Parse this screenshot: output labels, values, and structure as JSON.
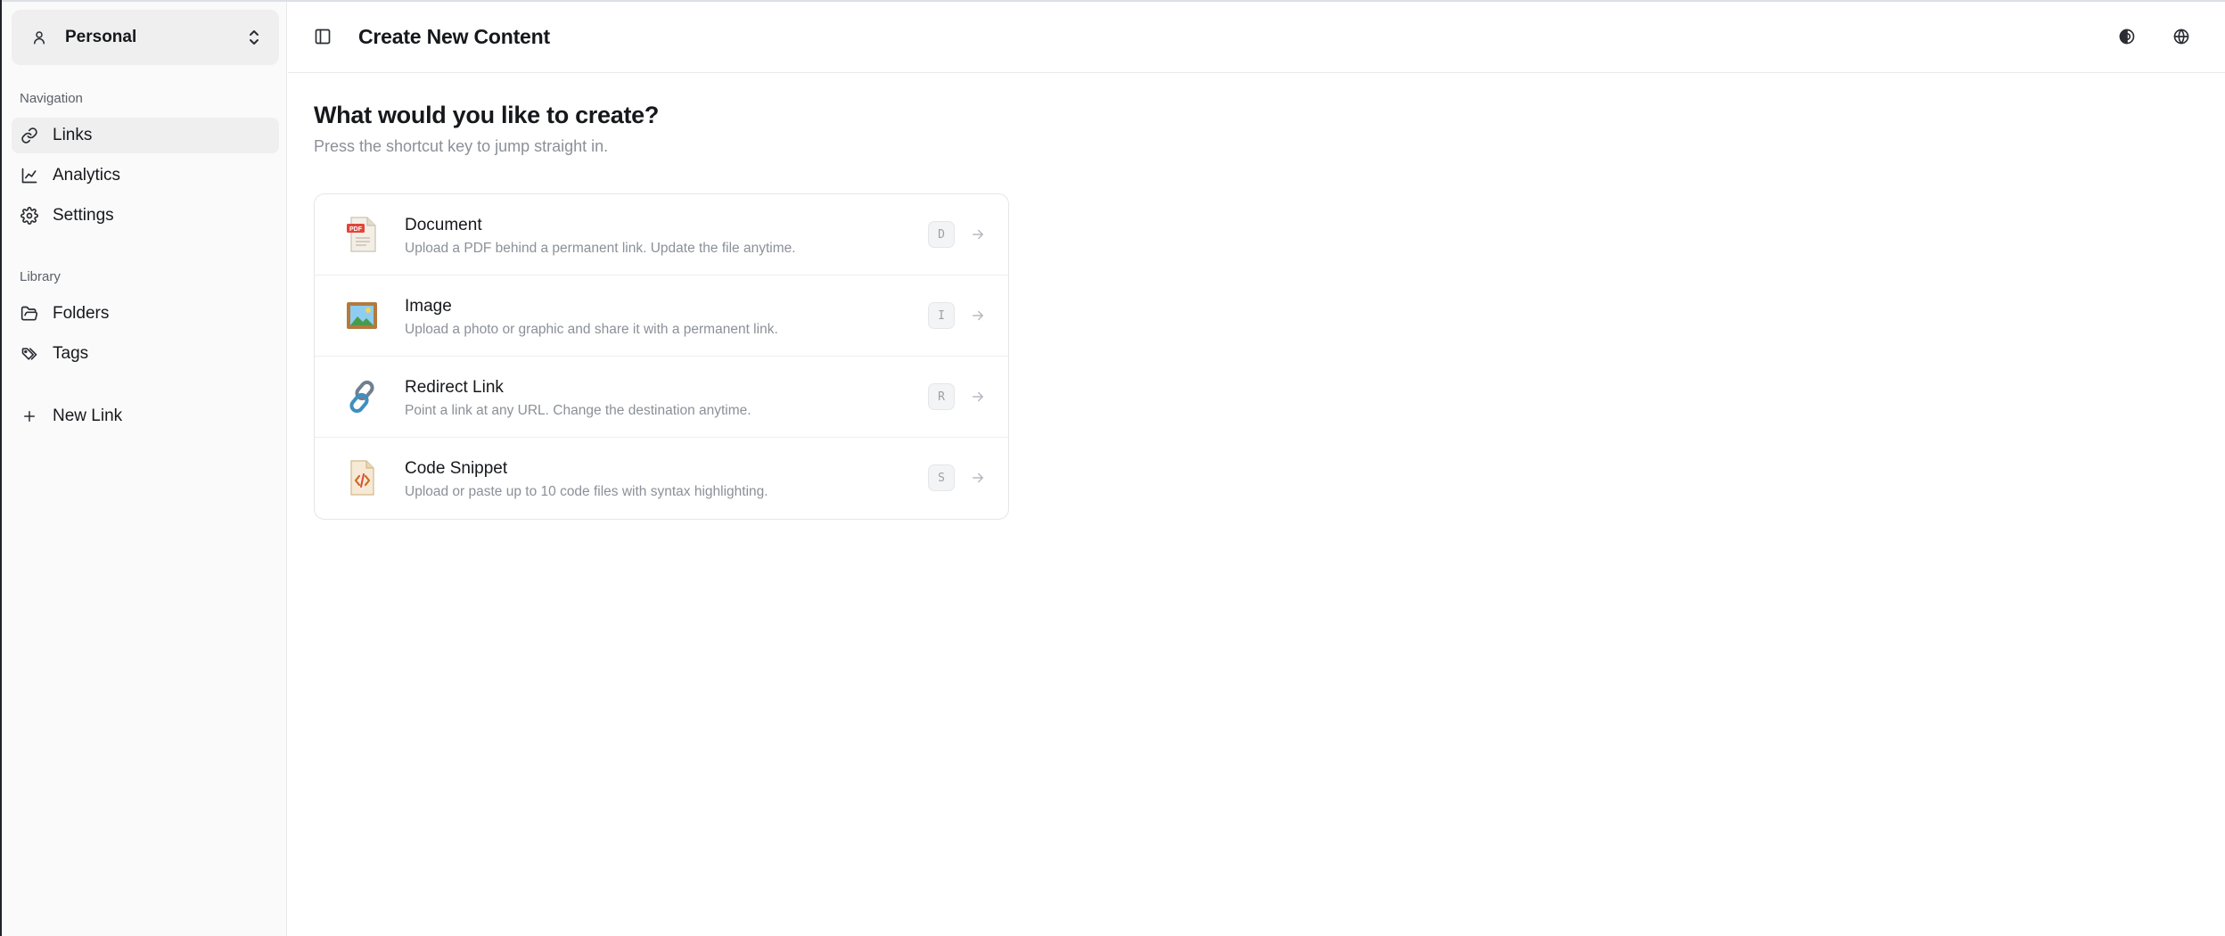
{
  "workspace": {
    "label": "Personal",
    "icon": "user-icon"
  },
  "sidebar": {
    "navigation_label": "Navigation",
    "nav_items": [
      {
        "label": "Links",
        "icon": "link-icon",
        "active": true
      },
      {
        "label": "Analytics",
        "icon": "chart-line-icon",
        "active": false
      },
      {
        "label": "Settings",
        "icon": "gear-icon",
        "active": false
      }
    ],
    "library_label": "Library",
    "library_items": [
      {
        "label": "Folders",
        "icon": "folder-open-icon"
      },
      {
        "label": "Tags",
        "icon": "tags-icon"
      }
    ],
    "new_link_label": "New Link"
  },
  "header": {
    "title": "Create New Content"
  },
  "main": {
    "heading": "What would you like to create?",
    "subheading": "Press the shortcut key to jump straight in.",
    "options": [
      {
        "title": "Document",
        "description": "Upload a PDF behind a permanent link. Update the file anytime.",
        "shortcut": "D",
        "icon": "pdf-document-icon"
      },
      {
        "title": "Image",
        "description": "Upload a photo or graphic and share it with a permanent link.",
        "shortcut": "I",
        "icon": "framed-picture-icon"
      },
      {
        "title": "Redirect Link",
        "description": "Point a link at any URL. Change the destination anytime.",
        "shortcut": "R",
        "icon": "chain-link-icon"
      },
      {
        "title": "Code Snippet",
        "description": "Upload or paste up to 10 code files with syntax highlighting.",
        "shortcut": "S",
        "icon": "code-file-icon"
      }
    ]
  },
  "colors": {
    "text": "#16181c",
    "muted": "#8b9098",
    "border": "#e4e6e9",
    "sidebar_bg": "#fafafa",
    "active_bg": "#efefef"
  }
}
